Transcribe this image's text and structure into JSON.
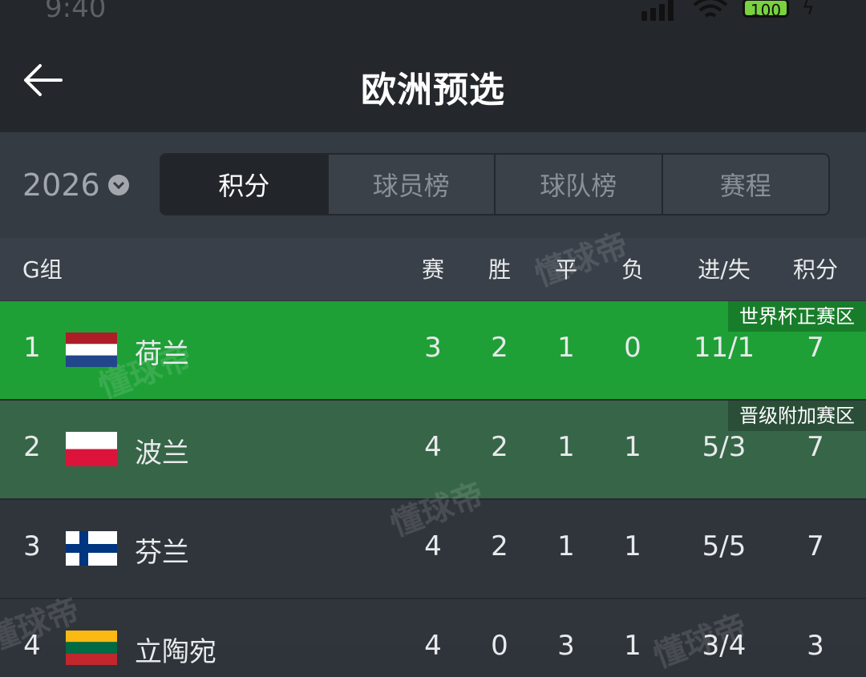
{
  "status_bar": {
    "time": "9:40",
    "battery": "100"
  },
  "header": {
    "title": "欧洲预选"
  },
  "controls": {
    "year": "2026",
    "tabs": [
      {
        "label": "积分",
        "active": true
      },
      {
        "label": "球员榜",
        "active": false
      },
      {
        "label": "球队榜",
        "active": false
      },
      {
        "label": "赛程",
        "active": false
      }
    ]
  },
  "table": {
    "group": "G组",
    "columns": [
      "赛",
      "胜",
      "平",
      "负",
      "进/失",
      "积分"
    ],
    "rows": [
      {
        "rank": "1",
        "team": "荷兰",
        "flag": "netherlands",
        "played": "3",
        "won": "2",
        "drawn": "1",
        "lost": "0",
        "goals": "11/1",
        "points": "7",
        "zone": "世界杯正赛区",
        "row_color": "#1fa037"
      },
      {
        "rank": "2",
        "team": "波兰",
        "flag": "poland",
        "played": "4",
        "won": "2",
        "drawn": "1",
        "lost": "1",
        "goals": "5/3",
        "points": "7",
        "zone": "晋级附加赛区",
        "row_color": "#376548"
      },
      {
        "rank": "3",
        "team": "芬兰",
        "flag": "finland",
        "played": "4",
        "won": "2",
        "drawn": "1",
        "lost": "1",
        "goals": "5/5",
        "points": "7",
        "row_color": "#30353c"
      },
      {
        "rank": "4",
        "team": "立陶宛",
        "flag": "lithuania",
        "played": "4",
        "won": "0",
        "drawn": "3",
        "lost": "1",
        "goals": "3/4",
        "points": "3",
        "row_color": "#30353c"
      }
    ]
  },
  "watermark": "懂球帝"
}
